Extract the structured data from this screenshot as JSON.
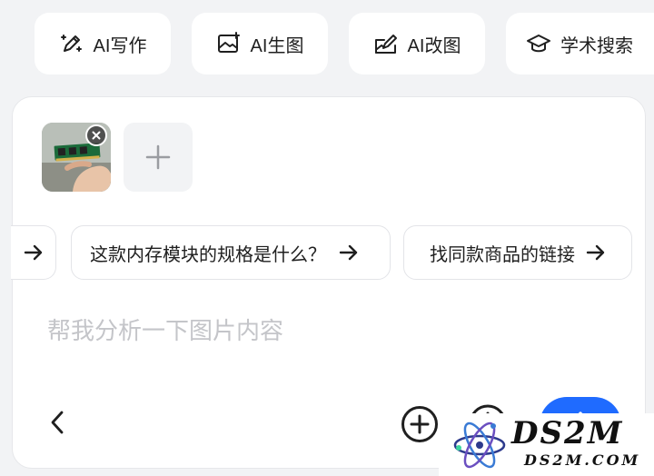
{
  "toolbar": {
    "items": [
      {
        "label": "AI写作",
        "icon": "pen-sparkle-icon"
      },
      {
        "label": "AI生图",
        "icon": "image-sparkle-icon"
      },
      {
        "label": "AI改图",
        "icon": "image-edit-icon"
      },
      {
        "label": "学术搜索",
        "icon": "graduation-cap-icon"
      }
    ]
  },
  "attachments": {
    "image_alt": "内存条图片",
    "add_icon": "plus-icon"
  },
  "suggestions": [
    {
      "label": "这款内存模块的规格是什么？"
    },
    {
      "label": "找同款商品的链接"
    }
  ],
  "composer": {
    "placeholder": "帮我分析一下图片内容",
    "value": ""
  },
  "actions": {
    "back_icon": "chevron-left-icon",
    "add_icon": "plus-circle-icon",
    "history_icon": "clock-icon",
    "send_icon": "send-icon",
    "send_color": "#1f6bff"
  },
  "watermark": {
    "title": "DS2M",
    "subtitle": "DS2M.COM"
  }
}
